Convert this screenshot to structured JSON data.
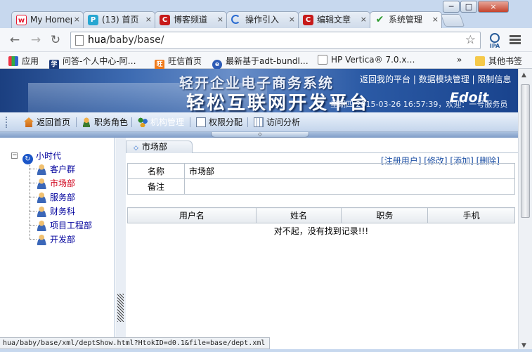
{
  "browser": {
    "tabs": [
      {
        "title": "My Homep",
        "icon": "weibo-icon",
        "color": "#e6162d",
        "active": false
      },
      {
        "title": "(13) 首页",
        "icon": "p-icon",
        "color": "#26a6d1",
        "active": false
      },
      {
        "title": "博客频道",
        "icon": "csdn-icon",
        "color": "#c71a1a",
        "active": false
      },
      {
        "title": "操作引入",
        "icon": "loading-icon",
        "color": "#2a6bd1",
        "active": false
      },
      {
        "title": "编辑文章",
        "icon": "csdn-icon",
        "color": "#c71a1a",
        "active": false
      },
      {
        "title": "系统管理",
        "icon": "check-icon",
        "color": "#2c9a2c",
        "active": true
      }
    ],
    "tab_close": "×",
    "window_controls": {
      "minimize": "─",
      "maximize": "□",
      "close": "×"
    },
    "address": {
      "host": "hua",
      "path": "/baby/base/"
    },
    "bookmarks": [
      {
        "label": "应用",
        "icon": "apps-icon"
      },
      {
        "label": "问答-个人中心-阿…",
        "icon": "dictionary-icon"
      },
      {
        "label": "旺信首页",
        "icon": "wangxin-icon"
      },
      {
        "label": "最新基于adt-bundl…",
        "icon": "browser-icon"
      },
      {
        "label": "HP Vertica® 7.0.x…",
        "icon": "page-icon"
      }
    ],
    "bookmarks_overflow": "»",
    "other_bookmarks": "其他书签",
    "ipa_label": "IPA",
    "status_url": "hua/baby/base/xml/deptShow.html?HtokID=d0.1&file=base/dept.xml"
  },
  "banner": {
    "title_line1": "轻开企业电子商务系统",
    "title_line2": "轻松互联网开发平台",
    "brand": "Edoit",
    "links": [
      "返回我的平台",
      "数据模块管理",
      "限制信息"
    ],
    "clock": "星期四 2015-03-26 16:57:39，欢迎：一号服务员"
  },
  "menu": [
    {
      "label": "返回首页",
      "icon": "home-icon"
    },
    {
      "label": "职务角色",
      "icon": "user-role-icon"
    },
    {
      "label": "机构管理",
      "icon": "org-icon",
      "active": true
    },
    {
      "label": "权限分配",
      "icon": "permission-icon"
    },
    {
      "label": "访问分析",
      "icon": "calendar-icon"
    }
  ],
  "tree": {
    "root": "小时代",
    "children": [
      {
        "label": "客户群",
        "selected": false
      },
      {
        "label": "市场部",
        "selected": true
      },
      {
        "label": "服务部",
        "selected": false
      },
      {
        "label": "财务科",
        "selected": false
      },
      {
        "label": "项目工程部",
        "selected": false
      },
      {
        "label": "开发部",
        "selected": false
      }
    ]
  },
  "content": {
    "breadcrumb": "市场部",
    "actions": [
      "[注册用户]",
      "[修改]",
      "[添加]",
      "[删除]"
    ],
    "info": {
      "name_label": "名称",
      "name_value": "市场部",
      "remark_label": "备注",
      "remark_value": ""
    },
    "users": {
      "columns": [
        "用户名",
        "姓名",
        "职务",
        "手机"
      ],
      "empty_message": "对不起，没有找到记录!!!"
    }
  }
}
